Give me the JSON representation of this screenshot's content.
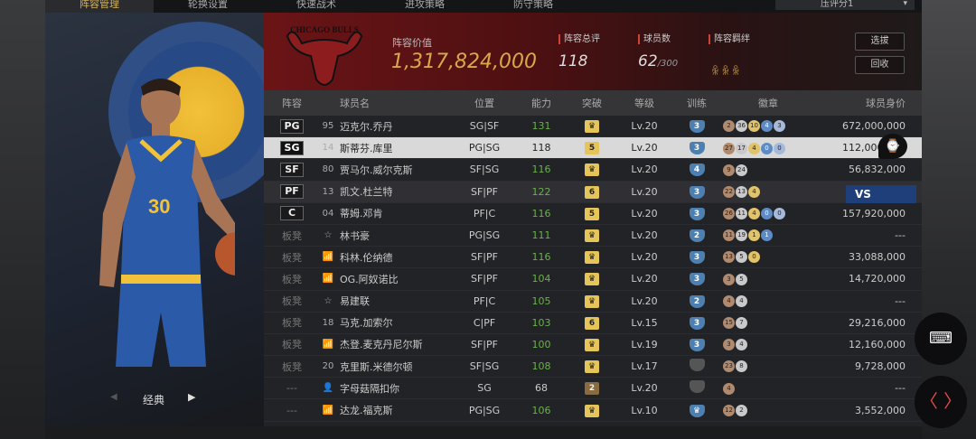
{
  "nav": {
    "tabs": [
      "阵容管理",
      "轮换设置",
      "快速战术",
      "进攻策略",
      "防守策略"
    ],
    "dropdown": "压评分1",
    "dropdown_arrow": "▾"
  },
  "left": {
    "selector_label": "经典",
    "prev": "◀",
    "next": "▶"
  },
  "header": {
    "lineup_value_label": "阵容价值",
    "lineup_value": "1,317,824,000",
    "rating_label": "阵容总评",
    "rating": "118",
    "count_label": "球员数",
    "count": "62",
    "count_max": "/300",
    "chem_label": "阵容羁绊",
    "chem_icons": "ꆜꆜꆜ",
    "btn_pick": "选拔",
    "btn_recycle": "回收",
    "team_logo_text": "CHICAGO BULLS"
  },
  "table": {
    "headers": [
      "阵容",
      "球员名",
      "位置",
      "能力",
      "突破",
      "等级",
      "训练",
      "徽章",
      "球员身价"
    ],
    "rows": [
      {
        "slot": "PG",
        "num": "95",
        "name": "迈克尔.乔丹",
        "pos": "SG|SF",
        "abil": "131",
        "brk": "♛",
        "lv": "Lv.20",
        "tr": "3",
        "badges": [
          "2",
          "36",
          "10",
          "4",
          "3"
        ],
        "sal": "672,000,000"
      },
      {
        "slot": "SG",
        "num": "14",
        "name": "斯蒂芬.库里",
        "pos": "PG|SG",
        "abil": "118",
        "brk": "5",
        "lv": "Lv.20",
        "tr": "3",
        "badges": [
          "27",
          "17",
          "4",
          "0",
          "0"
        ],
        "sal": "112,000,000"
      },
      {
        "slot": "SF",
        "num": "80",
        "name": "贾马尔.威尔克斯",
        "pos": "SF|SG",
        "abil": "116",
        "brk": "♛",
        "lv": "Lv.20",
        "tr": "4",
        "badges": [
          "9",
          "24"
        ],
        "sal": "56,832,000"
      },
      {
        "slot": "PF",
        "num": "13",
        "name": "凯文.杜兰特",
        "pos": "SF|PF",
        "abil": "122",
        "brk": "6",
        "lv": "Lv.20",
        "tr": "3",
        "badges": [
          "22",
          "13",
          "4"
        ],
        "sal": ""
      },
      {
        "slot": "C",
        "num": "04",
        "name": "蒂姆.邓肯",
        "pos": "PF|C",
        "abil": "116",
        "brk": "5",
        "lv": "Lv.20",
        "tr": "3",
        "badges": [
          "26",
          "11",
          "4",
          "0",
          "0"
        ],
        "sal": "157,920,000"
      },
      {
        "slot": "板凳",
        "num": "☆",
        "name": "林书豪",
        "pos": "PG|SG",
        "abil": "111",
        "brk": "♛",
        "lv": "Lv.20",
        "tr": "2",
        "badges": [
          "11",
          "19",
          "1",
          "1"
        ],
        "sal": "---"
      },
      {
        "slot": "板凳",
        "num": "📶",
        "name": "科林.伦纳德",
        "pos": "SF|PF",
        "abil": "116",
        "brk": "♛",
        "lv": "Lv.20",
        "tr": "3",
        "badges": [
          "13",
          "5",
          "0"
        ],
        "sal": "33,088,000"
      },
      {
        "slot": "板凳",
        "num": "📶",
        "name": "OG.阿奴诺比",
        "pos": "SF|PF",
        "abil": "104",
        "brk": "♛",
        "lv": "Lv.20",
        "tr": "3",
        "badges": [
          "3",
          "5"
        ],
        "sal": "14,720,000"
      },
      {
        "slot": "板凳",
        "num": "☆",
        "name": "易建联",
        "pos": "PF|C",
        "abil": "105",
        "brk": "♛",
        "lv": "Lv.20",
        "tr": "2",
        "badges": [
          "4",
          "4"
        ],
        "sal": "---"
      },
      {
        "slot": "板凳",
        "num": "18",
        "name": "马克.加索尔",
        "pos": "C|PF",
        "abil": "103",
        "brk": "6",
        "lv": "Lv.15",
        "tr": "3",
        "badges": [
          "15",
          "7"
        ],
        "sal": "29,216,000"
      },
      {
        "slot": "板凳",
        "num": "📶",
        "name": "杰登.麦克丹尼尔斯",
        "pos": "SF|PF",
        "abil": "100",
        "brk": "♛",
        "lv": "Lv.19",
        "tr": "3",
        "badges": [
          "3",
          "4"
        ],
        "sal": "12,160,000"
      },
      {
        "slot": "板凳",
        "num": "20",
        "name": "克里斯.米德尔顿",
        "pos": "SF|SG",
        "abil": "108",
        "brk": "♛",
        "lv": "Lv.17",
        "tr": "",
        "badges": [
          "23",
          "8"
        ],
        "sal": "9,728,000"
      },
      {
        "slot": "---",
        "num": "👤",
        "name": "字母菇隔扣你",
        "pos": "SG",
        "abil": "68",
        "brk": "2",
        "lv": "Lv.20",
        "tr": "",
        "badges": [
          "4"
        ],
        "sal": "---"
      },
      {
        "slot": "---",
        "num": "📶",
        "name": "达龙.福克斯",
        "pos": "PG|SG",
        "abil": "106",
        "brk": "♛",
        "lv": "Lv.10",
        "tr": "♛",
        "badges": [
          "12",
          "2"
        ],
        "sal": "3,552,000"
      }
    ]
  },
  "overlay": {
    "vs": "VS",
    "clock": "⌚",
    "keyboard": "⌨",
    "code": "〈 〉"
  }
}
